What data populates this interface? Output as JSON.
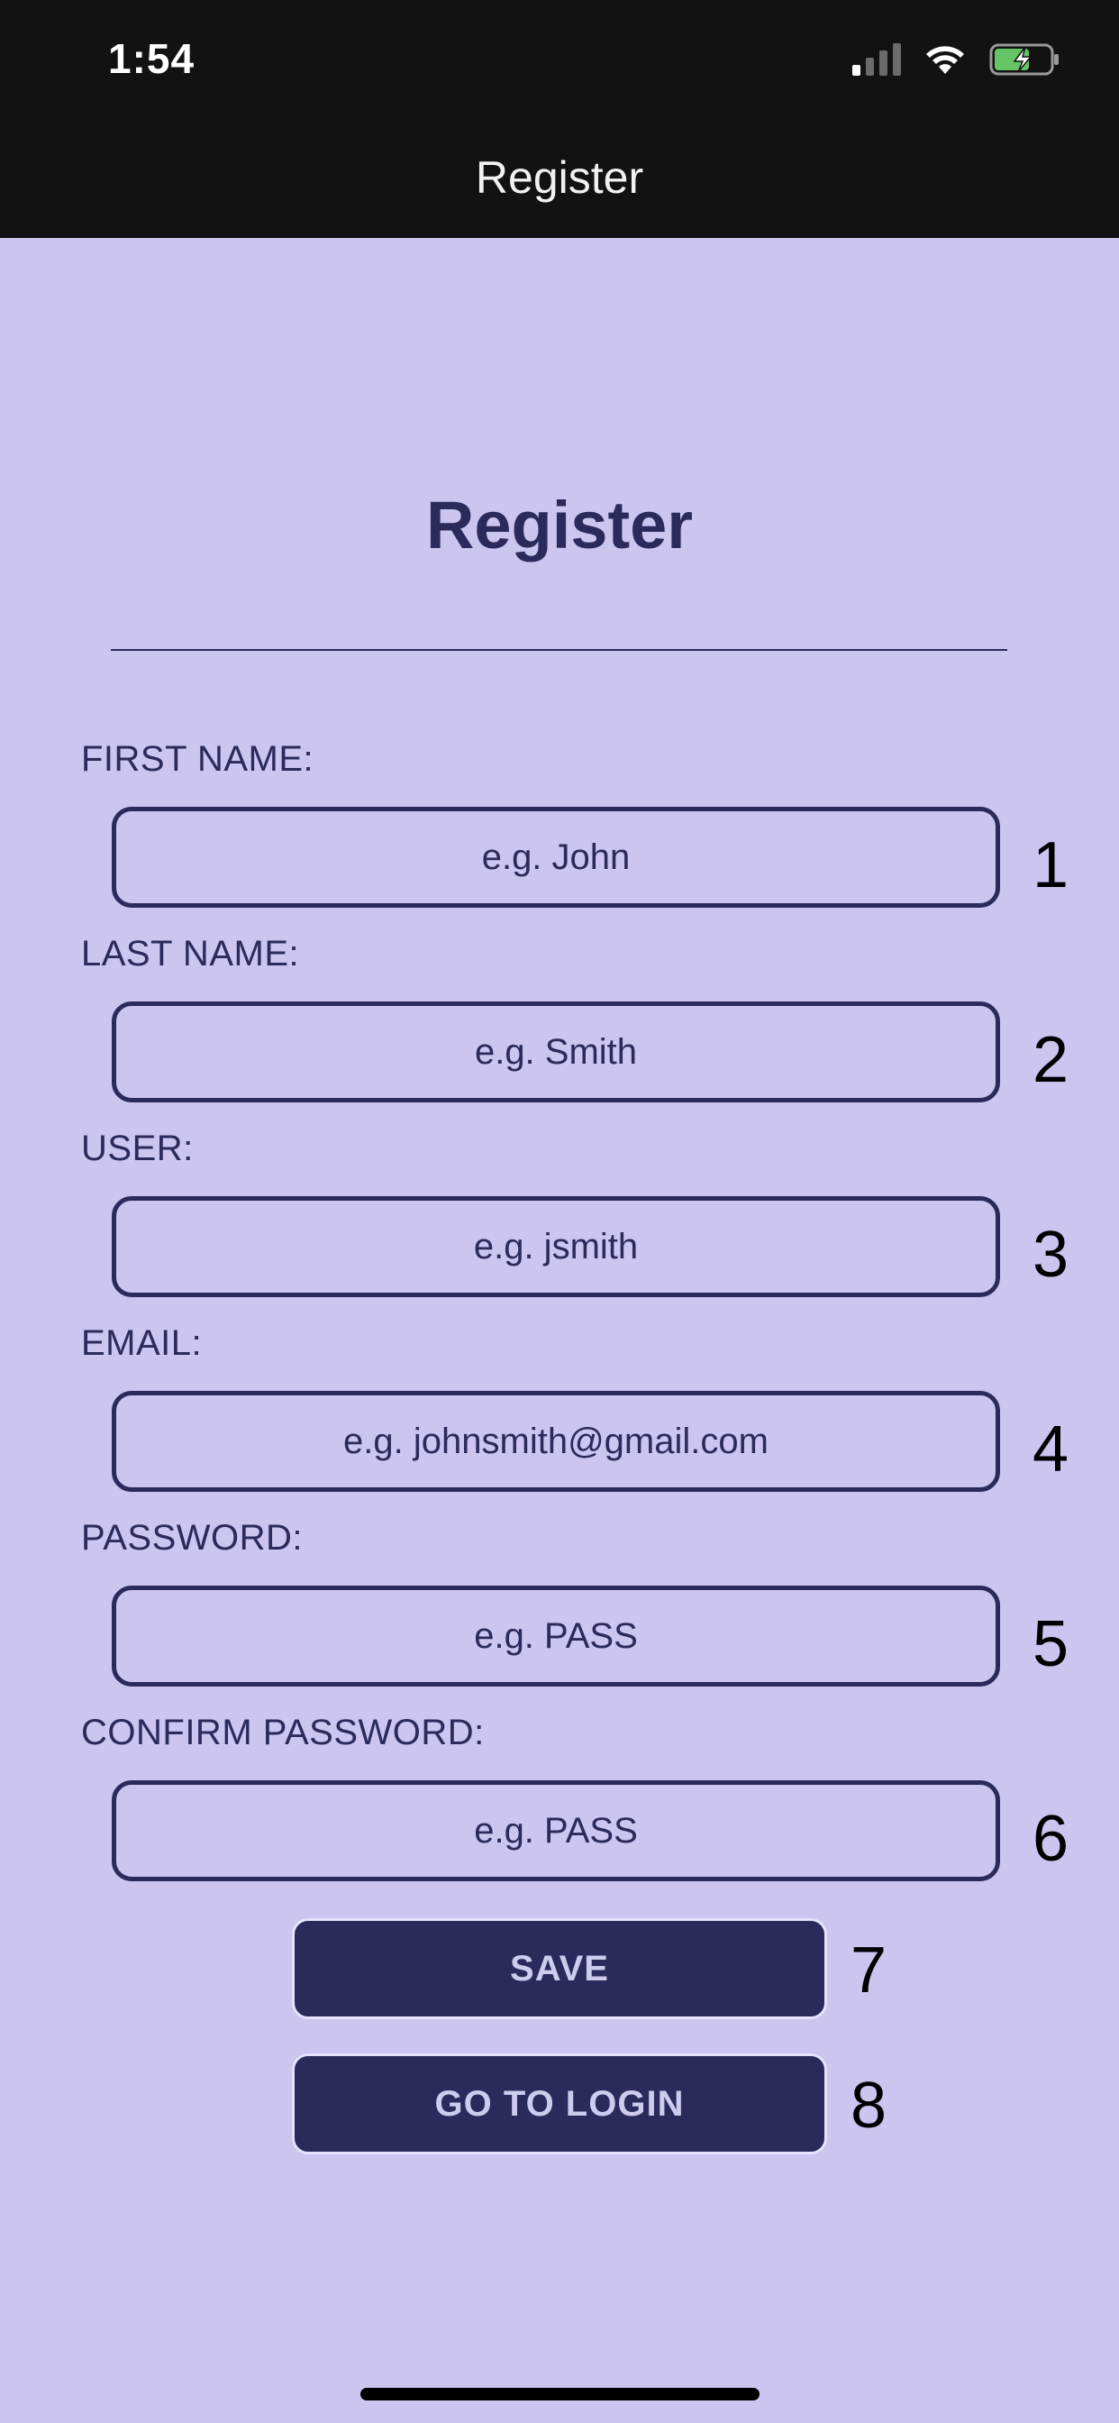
{
  "status_bar": {
    "time": "1:54"
  },
  "nav": {
    "title": "Register"
  },
  "page": {
    "title": "Register"
  },
  "fields": [
    {
      "label": "FIRST NAME:",
      "placeholder": "e.g. John",
      "value": "",
      "marker": "1"
    },
    {
      "label": "LAST NAME:",
      "placeholder": "e.g. Smith",
      "value": "",
      "marker": "2"
    },
    {
      "label": "USER:",
      "placeholder": "e.g. jsmith",
      "value": "",
      "marker": "3"
    },
    {
      "label": "EMAIL:",
      "placeholder": "e.g. johnsmith@gmail.com",
      "value": "",
      "marker": "4"
    },
    {
      "label": "PASSWORD:",
      "placeholder": "e.g. PASS",
      "value": "",
      "marker": "5"
    },
    {
      "label": "CONFIRM PASSWORD:",
      "placeholder": "e.g. PASS",
      "value": "",
      "marker": "6"
    }
  ],
  "buttons": {
    "save": {
      "label": "SAVE",
      "marker": "7"
    },
    "go_to_login": {
      "label": "GO TO LOGIN",
      "marker": "8"
    }
  },
  "colors": {
    "background": "#cbc5ef",
    "primary": "#2b2a5b",
    "topbar": "#121212",
    "battery_fill": "#65c466"
  },
  "icons": [
    "signal-icon",
    "wifi-icon",
    "battery-charging-icon"
  ]
}
